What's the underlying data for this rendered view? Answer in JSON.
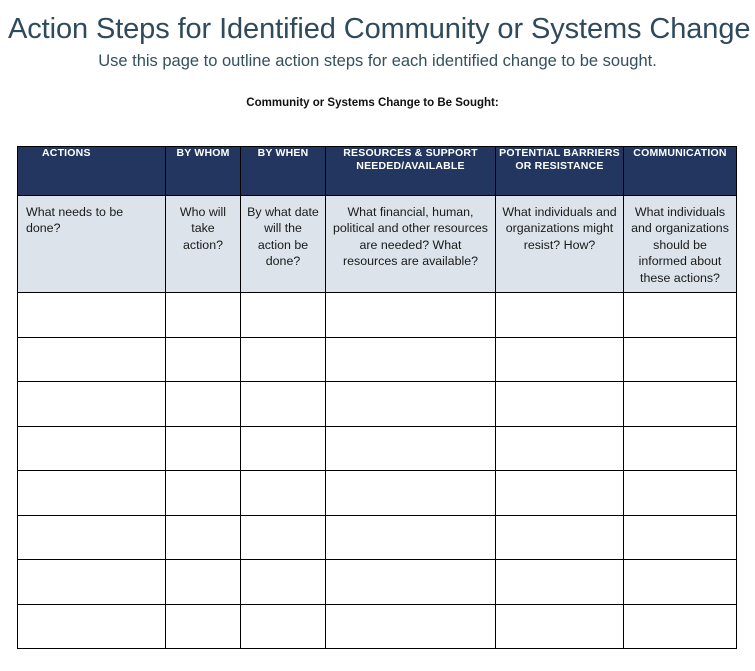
{
  "header": {
    "title": "Action Steps for Identified Community or Systems Change",
    "subtitle": "Use this page to outline action steps for each identified change to be sought.",
    "sought_label": "Community or Systems Change to Be Sought:"
  },
  "colors": {
    "title_text": "#2f4a5c",
    "table_header_bg": "#23365f",
    "table_header_text": "#ffffff",
    "description_row_bg": "#dce3ea",
    "border": "#000000",
    "page_bg": "#ffffff"
  },
  "table": {
    "columns": [
      {
        "header": "ACTIONS",
        "description": "What needs to be done?"
      },
      {
        "header": "BY WHOM",
        "description": "Who will take action?"
      },
      {
        "header": "BY WHEN",
        "description": "By what date will the action be done?"
      },
      {
        "header": "RESOURCES & SUPPORT NEEDED/AVAILABLE",
        "description": "What financial, human, political and other resources are needed? What resources are available?"
      },
      {
        "header": "POTENTIAL BARRIERS OR RESISTANCE",
        "description": "What individuals and organizations might resist? How?"
      },
      {
        "header": "COMMUNICATION",
        "description": "What individuals and organizations should be informed about these actions?"
      }
    ],
    "blank_rows": 8,
    "blank_cell_value": ""
  }
}
